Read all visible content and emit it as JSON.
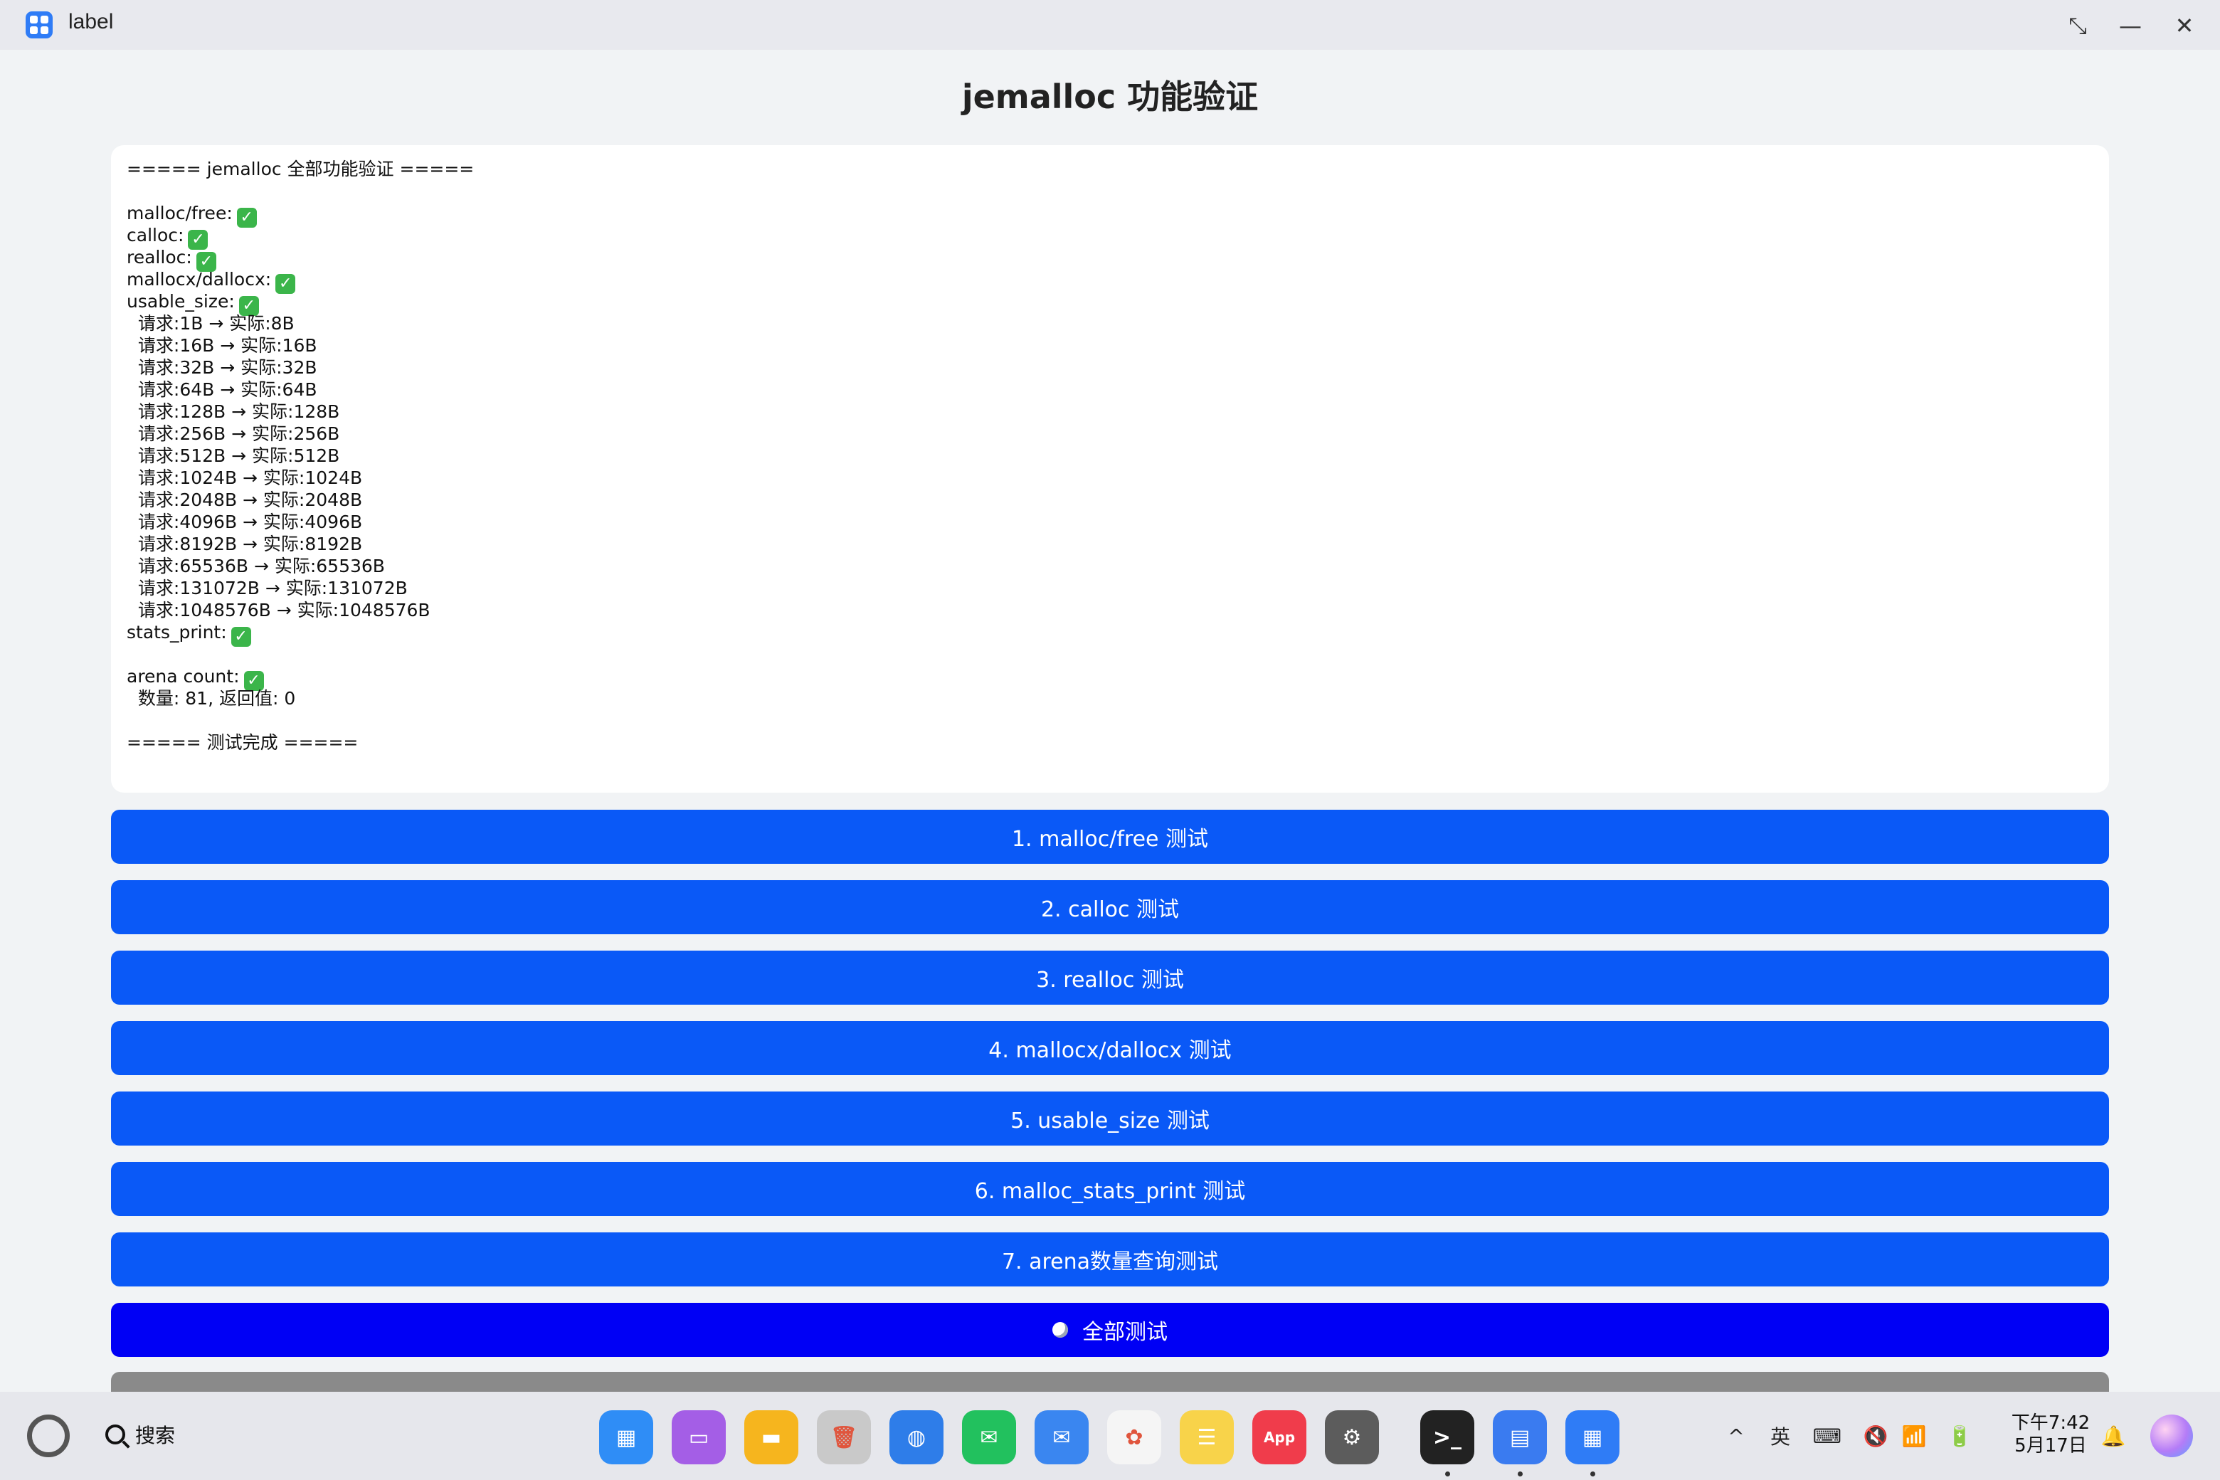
{
  "window": {
    "title": "label",
    "buttons": {
      "restore": "⤡",
      "minimize": "—",
      "close": "✕"
    }
  },
  "page": {
    "title": "jemalloc 功能验证"
  },
  "output": {
    "lines": [
      {
        "text": "===== jemalloc 全部功能验证 =====",
        "check": false
      },
      {
        "text": "",
        "check": false
      },
      {
        "text": "malloc/free:",
        "check": true
      },
      {
        "text": "calloc:",
        "check": true
      },
      {
        "text": "realloc:",
        "check": true
      },
      {
        "text": "mallocx/dallocx:",
        "check": true
      },
      {
        "text": "usable_size:",
        "check": true
      },
      {
        "text": "  请求:1B → 实际:8B",
        "check": false
      },
      {
        "text": "  请求:16B → 实际:16B",
        "check": false
      },
      {
        "text": "  请求:32B → 实际:32B",
        "check": false
      },
      {
        "text": "  请求:64B → 实际:64B",
        "check": false
      },
      {
        "text": "  请求:128B → 实际:128B",
        "check": false
      },
      {
        "text": "  请求:256B → 实际:256B",
        "check": false
      },
      {
        "text": "  请求:512B → 实际:512B",
        "check": false
      },
      {
        "text": "  请求:1024B → 实际:1024B",
        "check": false
      },
      {
        "text": "  请求:2048B → 实际:2048B",
        "check": false
      },
      {
        "text": "  请求:4096B → 实际:4096B",
        "check": false
      },
      {
        "text": "  请求:8192B → 实际:8192B",
        "check": false
      },
      {
        "text": "  请求:65536B → 实际:65536B",
        "check": false
      },
      {
        "text": "  请求:131072B → 实际:131072B",
        "check": false
      },
      {
        "text": "  请求:1048576B → 实际:1048576B",
        "check": false
      },
      {
        "text": "stats_print:",
        "check": true
      },
      {
        "text": "",
        "check": false
      },
      {
        "text": "arena count:",
        "check": true
      },
      {
        "text": "  数量: 81, 返回值: 0",
        "check": false
      },
      {
        "text": "",
        "check": false
      },
      {
        "text": "===== 测试完成 =====",
        "check": false
      }
    ],
    "check_glyph": "✓"
  },
  "buttons": [
    {
      "label": "1. malloc/free 测试"
    },
    {
      "label": "2. calloc 测试"
    },
    {
      "label": "3. realloc 测试"
    },
    {
      "label": "4. mallocx/dallocx 测试"
    },
    {
      "label": "5. usable_size 测试"
    },
    {
      "label": "6. malloc_stats_print 测试"
    },
    {
      "label": "7. arena数量查询测试"
    },
    {
      "label": "全部测试"
    }
  ],
  "colors": {
    "button_blue": "#0a59f7",
    "button_all": "#0000f5",
    "button_clear": "#8a8a8a",
    "check_green": "#3bb54a"
  },
  "taskbar": {
    "search_label": "搜索",
    "dock": [
      {
        "name": "launcher",
        "color": "#2f8df6",
        "glyph": "▦"
      },
      {
        "name": "multitask",
        "color": "#a45ee6",
        "glyph": "▭"
      },
      {
        "name": "files",
        "color": "#f6b51e",
        "glyph": "▬"
      },
      {
        "name": "recycle-bin",
        "color": "#c9c9c9",
        "glyph": "🗑"
      },
      {
        "name": "browser",
        "color": "#2e7de9",
        "glyph": "◍"
      },
      {
        "name": "wechat",
        "color": "#22c15e",
        "glyph": "✉"
      },
      {
        "name": "mail",
        "color": "#3a86f0",
        "glyph": "✉"
      },
      {
        "name": "photos",
        "color": "#f5f5f5",
        "glyph": "✿"
      },
      {
        "name": "notes",
        "color": "#f8d34a",
        "glyph": "☰"
      },
      {
        "name": "app-gallery",
        "color": "#f03c4b",
        "glyph": "App"
      },
      {
        "name": "settings",
        "color": "#5c5c5c",
        "glyph": "⚙"
      },
      {
        "name": "terminal",
        "color": "#222222",
        "glyph": ">_"
      },
      {
        "name": "document",
        "color": "#3a7bf0",
        "glyph": "▤"
      },
      {
        "name": "label-app",
        "color": "#2f7cf6",
        "glyph": "▦"
      }
    ],
    "tray": {
      "chevron": "^",
      "ime": "英",
      "keyboard": "⌨",
      "volume": "🔇",
      "wifi": "📶",
      "battery": "🔋",
      "notification": "🔔"
    },
    "clock_time": "下午7:42",
    "clock_date": "5月17日"
  }
}
